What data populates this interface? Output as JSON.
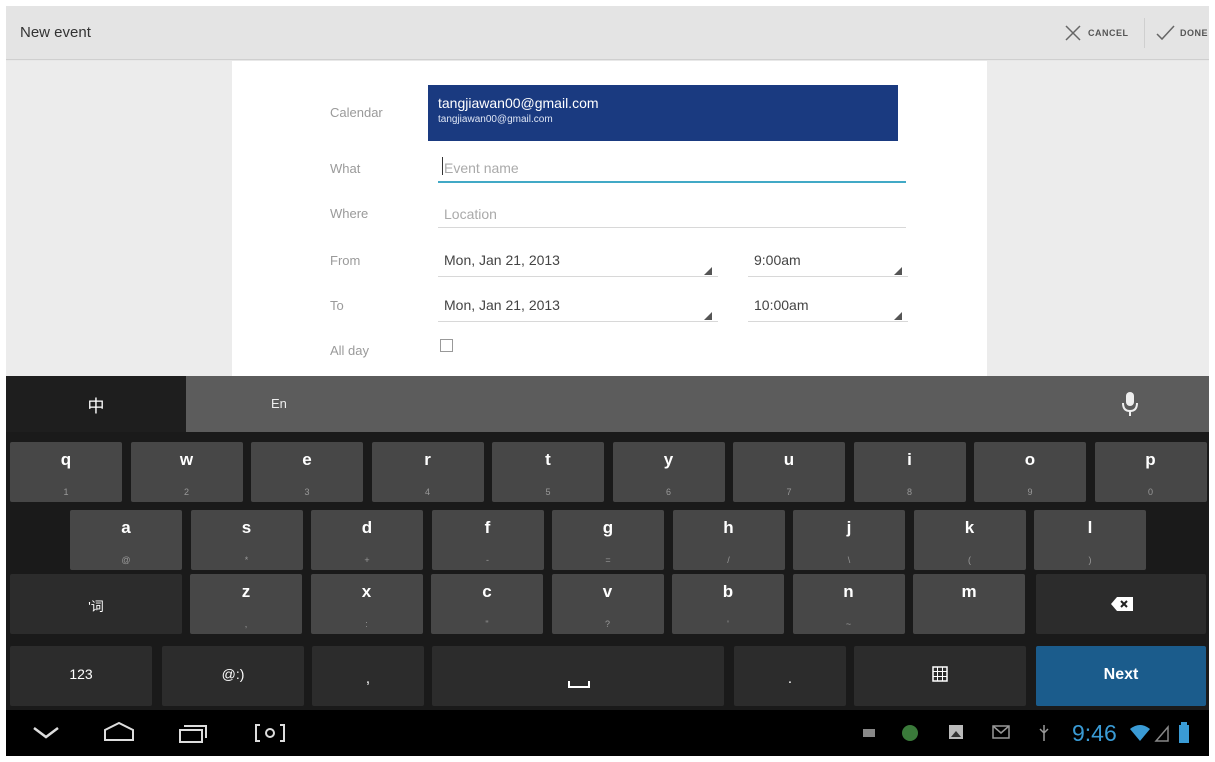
{
  "actionbar": {
    "title": "New event",
    "cancel_label": "CANCEL",
    "done_label": "DONE"
  },
  "form": {
    "calendar_label": "Calendar",
    "calendar_account": "tangjiawan00@gmail.com",
    "calendar_account_sub": "tangjiawan00@gmail.com",
    "what_label": "What",
    "what_placeholder": "Event name",
    "where_label": "Where",
    "where_placeholder": "Location",
    "from_label": "From",
    "from_date": "Mon, Jan 21, 2013",
    "from_time": "9:00am",
    "to_label": "To",
    "to_date": "Mon, Jan 21, 2013",
    "to_time": "10:00am",
    "allday_label": "All day",
    "allday_checked": false
  },
  "keyboard": {
    "tab_zh": "中",
    "tab_en": "En",
    "row1": [
      {
        "k": "q",
        "s": "1"
      },
      {
        "k": "w",
        "s": "2"
      },
      {
        "k": "e",
        "s": "3"
      },
      {
        "k": "r",
        "s": "4"
      },
      {
        "k": "t",
        "s": "5"
      },
      {
        "k": "y",
        "s": "6"
      },
      {
        "k": "u",
        "s": "7"
      },
      {
        "k": "i",
        "s": "8"
      },
      {
        "k": "o",
        "s": "9"
      },
      {
        "k": "p",
        "s": "0"
      }
    ],
    "row2": [
      {
        "k": "a",
        "s": "@"
      },
      {
        "k": "s",
        "s": "*"
      },
      {
        "k": "d",
        "s": "+"
      },
      {
        "k": "f",
        "s": "-"
      },
      {
        "k": "g",
        "s": "="
      },
      {
        "k": "h",
        "s": "/"
      },
      {
        "k": "j",
        "s": "\\"
      },
      {
        "k": "k",
        "s": "("
      },
      {
        "k": "l",
        "s": ")"
      }
    ],
    "shift_label": "'词",
    "row3": [
      {
        "k": "z",
        "s": ","
      },
      {
        "k": "x",
        "s": ":"
      },
      {
        "k": "c",
        "s": "\""
      },
      {
        "k": "v",
        "s": "?"
      },
      {
        "k": "b",
        "s": "'"
      },
      {
        "k": "n",
        "s": "~"
      },
      {
        "k": "m",
        "s": ""
      }
    ],
    "num_label": "123",
    "emoji_label": "@:)",
    "comma_label": ",",
    "period_label": ".",
    "next_label": "Next"
  },
  "statusbar": {
    "time": "9:46"
  },
  "colors": {
    "accent": "#41a9c6",
    "calendar_bg": "#1a3a80",
    "next_key": "#1b5c8c",
    "clock": "#3a9bd5"
  }
}
